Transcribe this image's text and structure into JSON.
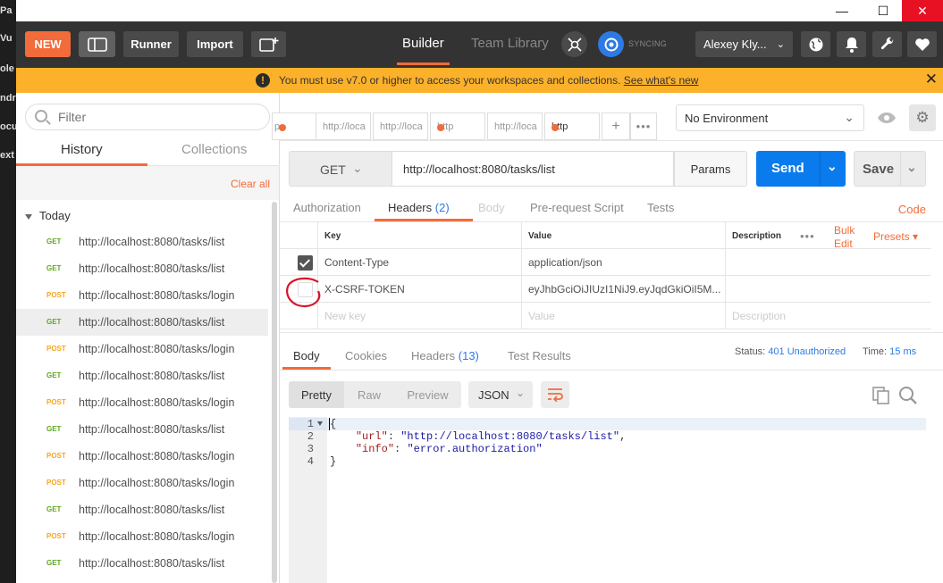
{
  "background_app": {
    "fragments": [
      "Pa",
      "Vu",
      "ole",
      "ndr",
      "ocu",
      "ext"
    ]
  },
  "window": {
    "minimize": "—",
    "maximize": "☐",
    "close": "✕"
  },
  "header": {
    "new_label": "NEW",
    "runner_label": "Runner",
    "import_label": "Import",
    "builder_tab": "Builder",
    "team_library_tab": "Team Library",
    "sync_status": "SYNCING",
    "user_name": "Alexey Kly..."
  },
  "banner": {
    "icon": "!",
    "text": "You must use v7.0 or higher to access your workspaces and collections.",
    "link": "See what's new",
    "close": "✕"
  },
  "sidebar": {
    "filter_placeholder": "Filter",
    "tabs": [
      "History",
      "Collections"
    ],
    "clear_all": "Clear all",
    "group": "Today",
    "history": [
      {
        "method": "GET",
        "url": "http://localhost:8080/tasks/list"
      },
      {
        "method": "GET",
        "url": "http://localhost:8080/tasks/list"
      },
      {
        "method": "POST",
        "url": "http://localhost:8080/tasks/login"
      },
      {
        "method": "GET",
        "url": "http://localhost:8080/tasks/list",
        "selected": true
      },
      {
        "method": "POST",
        "url": "http://localhost:8080/tasks/login"
      },
      {
        "method": "GET",
        "url": "http://localhost:8080/tasks/list"
      },
      {
        "method": "POST",
        "url": "http://localhost:8080/tasks/login"
      },
      {
        "method": "GET",
        "url": "http://localhost:8080/tasks/list"
      },
      {
        "method": "POST",
        "url": "http://localhost:8080/tasks/login"
      },
      {
        "method": "POST",
        "url": "http://localhost:8080/tasks/login"
      },
      {
        "method": "GET",
        "url": "http://localhost:8080/tasks/list"
      },
      {
        "method": "POST",
        "url": "http://localhost:8080/tasks/login"
      },
      {
        "method": "GET",
        "url": "http://localhost:8080/tasks/list"
      }
    ]
  },
  "request_tabs": [
    {
      "label": "p",
      "dot": true
    },
    {
      "label": "http://loca",
      "dot": false
    },
    {
      "label": "http://loca",
      "dot": false
    },
    {
      "label": "http",
      "dot": true
    },
    {
      "label": "http://loca",
      "dot": false
    },
    {
      "label": "http",
      "dot": true,
      "active": true
    }
  ],
  "tab_add": "+",
  "tab_more": "•••",
  "environment": {
    "selected": "No Environment"
  },
  "request": {
    "method": "GET",
    "url": "http://localhost:8080/tasks/list",
    "params_label": "Params",
    "send_label": "Send",
    "save_label": "Save"
  },
  "request_sections": {
    "authorization": "Authorization",
    "headers": "Headers",
    "headers_count": "(2)",
    "body": "Body",
    "prerequest": "Pre-request Script",
    "tests": "Tests",
    "code": "Code"
  },
  "headers_table": {
    "col_key": "Key",
    "col_value": "Value",
    "col_description": "Description",
    "more": "•••",
    "bulk_edit_1": "Bulk",
    "bulk_edit_2": "Edit",
    "presets": "Presets",
    "rows": [
      {
        "checked": true,
        "key": "Content-Type",
        "value": "application/json",
        "description": ""
      },
      {
        "checked": false,
        "key": "X-CSRF-TOKEN",
        "value": "eyJhbGciOiJIUzI1NiJ9.eyJqdGkiOiI5M...",
        "description": ""
      }
    ],
    "new_key_placeholder": "New key",
    "new_value_placeholder": "Value",
    "new_description_placeholder": "Description"
  },
  "response": {
    "tabs": {
      "body": "Body",
      "cookies": "Cookies",
      "headers": "Headers",
      "headers_count": "(13)",
      "test_results": "Test Results"
    },
    "status_label": "Status:",
    "status_value": "401 Unauthorized",
    "time_label": "Time:",
    "time_value": "15 ms",
    "views": [
      "Pretty",
      "Raw",
      "Preview"
    ],
    "format": "JSON",
    "line_numbers": [
      "1",
      "2",
      "3",
      "4"
    ],
    "body_lines": {
      "open": "{",
      "url_key": "\"url\"",
      "url_value": "\"http://localhost:8080/tasks/list\"",
      "info_key": "\"info\"",
      "info_value": "\"error.authorization\"",
      "close": "}"
    }
  },
  "colors": {
    "accent": "#f26b3a",
    "primary": "#097bed",
    "banner": "#fcb12a",
    "get": "#5ea81d",
    "post": "#f6a623",
    "annotation": "#d9152a"
  },
  "icons": [
    "layout-icon",
    "new-window-icon",
    "interceptor-icon",
    "sync-icon",
    "globe-icon",
    "bell-icon",
    "wrench-icon",
    "heart-icon",
    "eye-icon",
    "gear-icon",
    "wrap-icon",
    "copy-icon",
    "search-icon"
  ]
}
